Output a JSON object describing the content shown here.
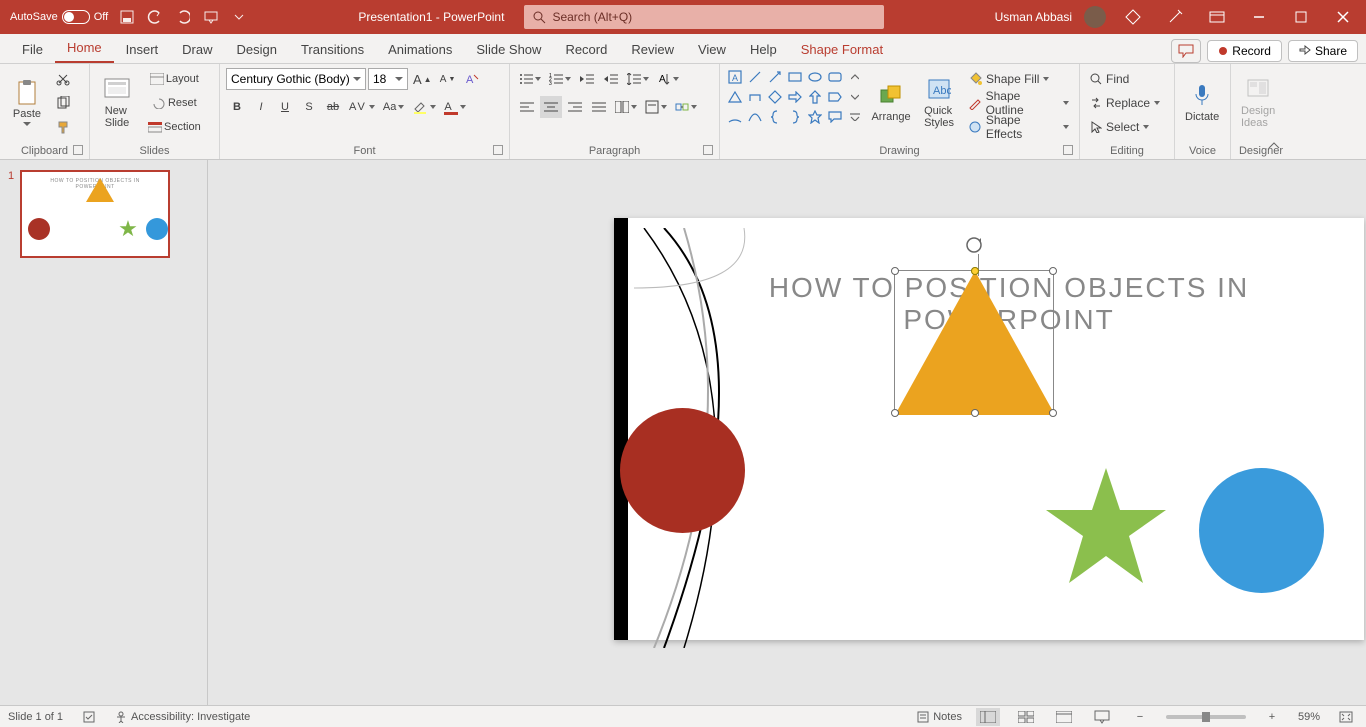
{
  "titlebar": {
    "autosave_label": "AutoSave",
    "autosave_state": "Off",
    "doc_title": "Presentation1 - PowerPoint",
    "search_placeholder": "Search (Alt+Q)",
    "user_name": "Usman Abbasi"
  },
  "menu": {
    "tabs": [
      "File",
      "Home",
      "Insert",
      "Draw",
      "Design",
      "Transitions",
      "Animations",
      "Slide Show",
      "Record",
      "Review",
      "View",
      "Help",
      "Shape Format"
    ],
    "active": "Home",
    "record_btn": "Record",
    "share_btn": "Share"
  },
  "ribbon": {
    "clipboard": {
      "paste": "Paste",
      "label": "Clipboard"
    },
    "slides": {
      "new_slide": "New\nSlide",
      "layout": "Layout",
      "reset": "Reset",
      "section": "Section",
      "label": "Slides"
    },
    "font": {
      "name": "Century Gothic (Body)",
      "size": "18",
      "label": "Font"
    },
    "paragraph": {
      "label": "Paragraph"
    },
    "drawing": {
      "arrange": "Arrange",
      "quick_styles": "Quick\nStyles",
      "shape_fill": "Shape Fill",
      "shape_outline": "Shape Outline",
      "shape_effects": "Shape Effects",
      "label": "Drawing"
    },
    "editing": {
      "find": "Find",
      "replace": "Replace",
      "select": "Select",
      "label": "Editing"
    },
    "voice": {
      "dictate": "Dictate",
      "label": "Voice"
    },
    "designer": {
      "design_ideas": "Design\nIdeas",
      "label": "Designer"
    }
  },
  "slide": {
    "title": "HOW TO POSITION OBJECTS  IN POWERPOINT",
    "thumb_title": "HOW TO POSITION OBJECTS  IN POWERPOINT",
    "number": "1"
  },
  "statusbar": {
    "slide_info": "Slide 1 of 1",
    "accessibility": "Accessibility: Investigate",
    "notes": "Notes",
    "zoom": "59%"
  }
}
